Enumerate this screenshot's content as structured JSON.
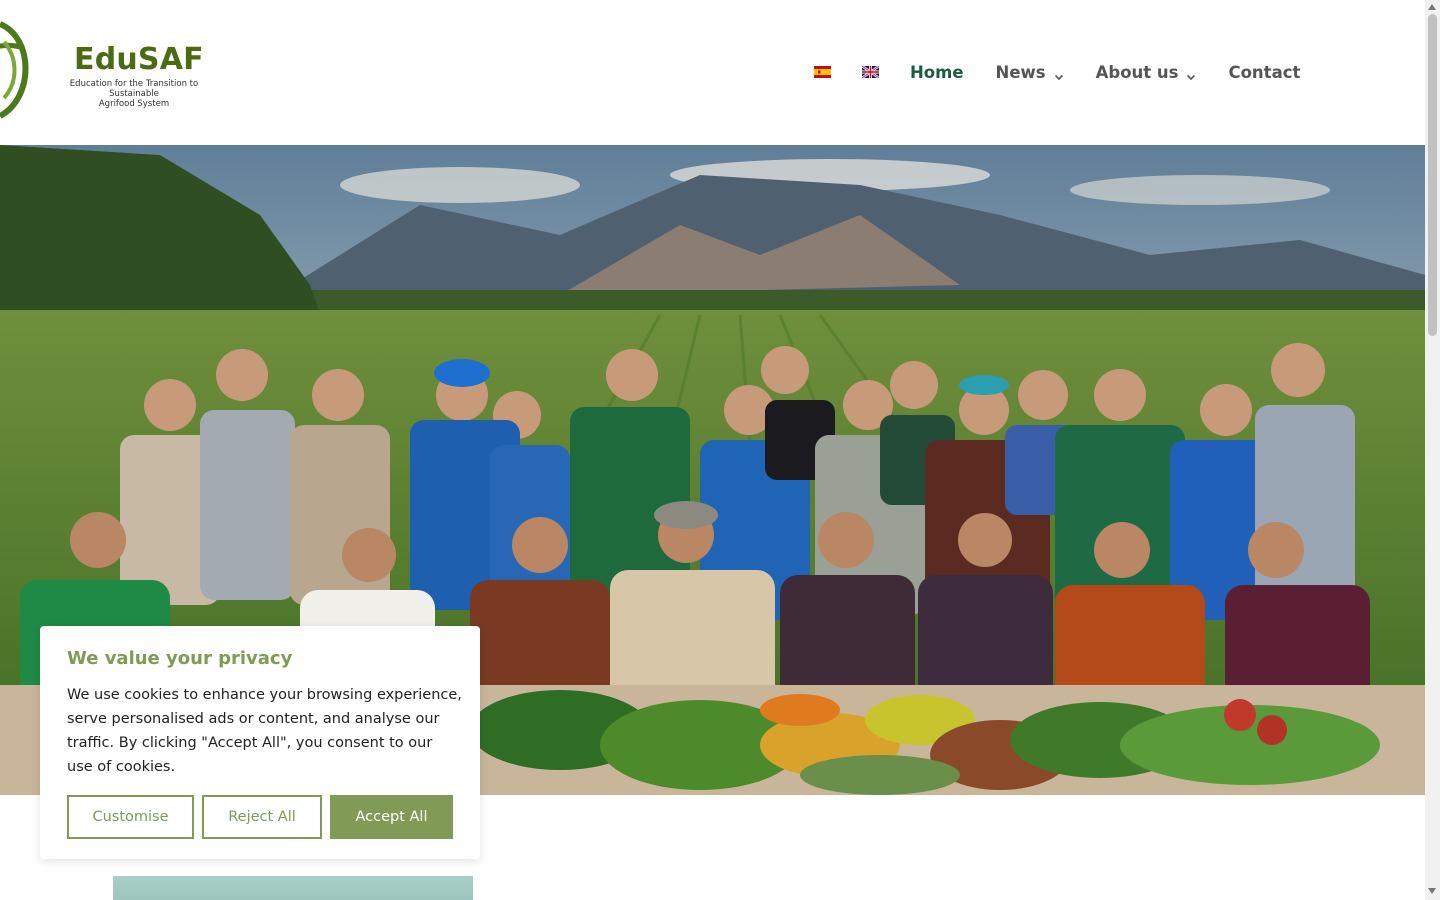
{
  "header": {
    "logo_title": "EduSAF",
    "logo_subtitle_line1": "Education for the Transition to Sustainable",
    "logo_subtitle_line2": "Agrifood System"
  },
  "nav": {
    "flags": [
      {
        "icon": "spain-flag-icon",
        "language": "Spanish"
      },
      {
        "icon": "uk-flag-icon",
        "language": "English"
      }
    ],
    "items": [
      {
        "label": "Home",
        "active": true,
        "has_dropdown": false
      },
      {
        "label": "News",
        "active": false,
        "has_dropdown": true
      },
      {
        "label": "About us",
        "active": false,
        "has_dropdown": true
      },
      {
        "label": "Contact",
        "active": false,
        "has_dropdown": false
      }
    ]
  },
  "hero": {
    "icon": "hero-photo-farmers-group"
  },
  "cookie": {
    "title": "We value your privacy",
    "text": "We use cookies to enhance your browsing experience, serve personalised ads or content, and analyse our traffic. By clicking \"Accept All\", you consent to our use of cookies.",
    "customise_label": "Customise",
    "reject_label": "Reject All",
    "accept_label": "Accept All"
  },
  "colors": {
    "brand_green": "#4a6b12",
    "nav_active": "#1b5e3f",
    "cookie_accent": "#7f9b55"
  }
}
